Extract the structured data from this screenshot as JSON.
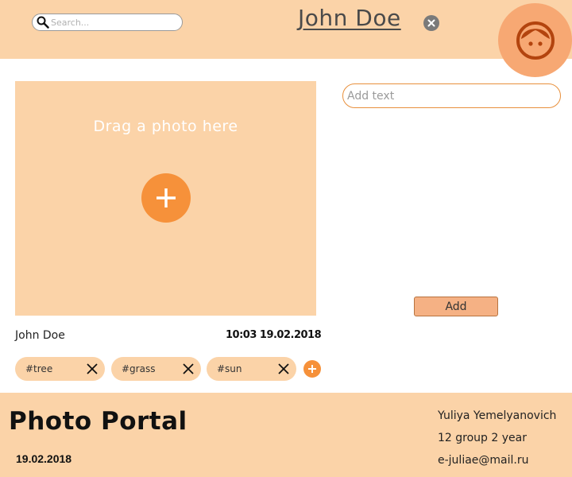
{
  "header": {
    "search_placeholder": "Search...",
    "user_name": "John Doe",
    "icons": {
      "search": "magnifier-icon",
      "close": "close-circle-icon",
      "avatar": "user-face-icon"
    }
  },
  "upload": {
    "drop_text": "Drag a photo here",
    "add_icon": "plus-icon"
  },
  "post": {
    "author": "John Doe",
    "timestamp": "10:03 19.02.2018",
    "tags": [
      {
        "label": "#tree"
      },
      {
        "label": "#grass"
      },
      {
        "label": "#sun"
      }
    ]
  },
  "comment": {
    "placeholder": "Add text",
    "value": "",
    "add_label": "Add"
  },
  "footer": {
    "brand": "Photo Portal",
    "date": "19.02.2018",
    "credits": [
      "Yuliya Yemelyanovich",
      "12 group 2 year",
      "e-juliae@mail.ru"
    ]
  },
  "colors": {
    "panel": "#fbd3a8",
    "accent": "#f6913a",
    "avatar_bg": "#f7a873",
    "button": "#f5b184"
  }
}
